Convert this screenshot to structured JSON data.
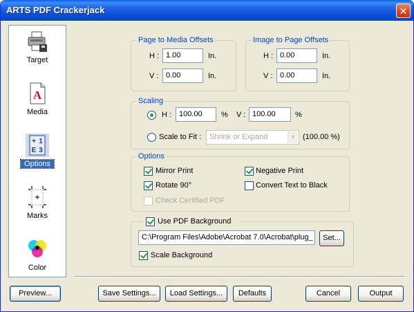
{
  "window": {
    "title": "ARTS PDF Crackerjack"
  },
  "sidebar": {
    "items": [
      {
        "label": "Target",
        "icon": "printer-icon"
      },
      {
        "label": "Media",
        "icon": "pdf-document-icon"
      },
      {
        "label": "Options",
        "icon": "options-grid-icon",
        "selected": true
      },
      {
        "label": "Marks",
        "icon": "crop-marks-icon"
      },
      {
        "label": "Color",
        "icon": "cmy-color-icon"
      }
    ]
  },
  "page_to_media": {
    "title": "Page to Media Offsets",
    "h_label": "H :",
    "h_value": "1.00",
    "h_unit": "In.",
    "v_label": "V :",
    "v_value": "0.00",
    "v_unit": "In."
  },
  "image_to_page": {
    "title": "Image to Page Offsets",
    "h_label": "H :",
    "h_value": "0.00",
    "h_unit": "In.",
    "v_label": "V :",
    "v_value": "0.00",
    "v_unit": "In."
  },
  "scaling": {
    "title": "Scaling",
    "h_label": "H :",
    "h_value": "100.00",
    "h_unit": "%",
    "v_label": "V :",
    "v_value": "100.00",
    "v_unit": "%",
    "scale_to_fit_label": "Scale to Fit :",
    "fit_option": "Shrink or Expand",
    "fit_percent": "(100.00 %)"
  },
  "options": {
    "title": "Options",
    "mirror_print": "Mirror Print",
    "rotate_90": "Rotate 90°",
    "check_certified": "Check Certified PDF",
    "negative_print": "Negative Print",
    "convert_text": "Convert Text to Black"
  },
  "background": {
    "use_label": "Use PDF Background",
    "path": "C:\\Program Files\\Adobe\\Acrobat 7.0\\Acrobat\\plug_",
    "set_label": "Set...",
    "scale_label": "Scale Background"
  },
  "buttons": {
    "preview": "Preview...",
    "save_settings": "Save Settings...",
    "load_settings": "Load Settings...",
    "defaults": "Defaults",
    "cancel": "Cancel",
    "output": "Output"
  },
  "colors": {
    "title_bar": "#0b4ed8",
    "group_title": "#0046d5",
    "selection": "#316ac5",
    "check": "#21a121"
  }
}
